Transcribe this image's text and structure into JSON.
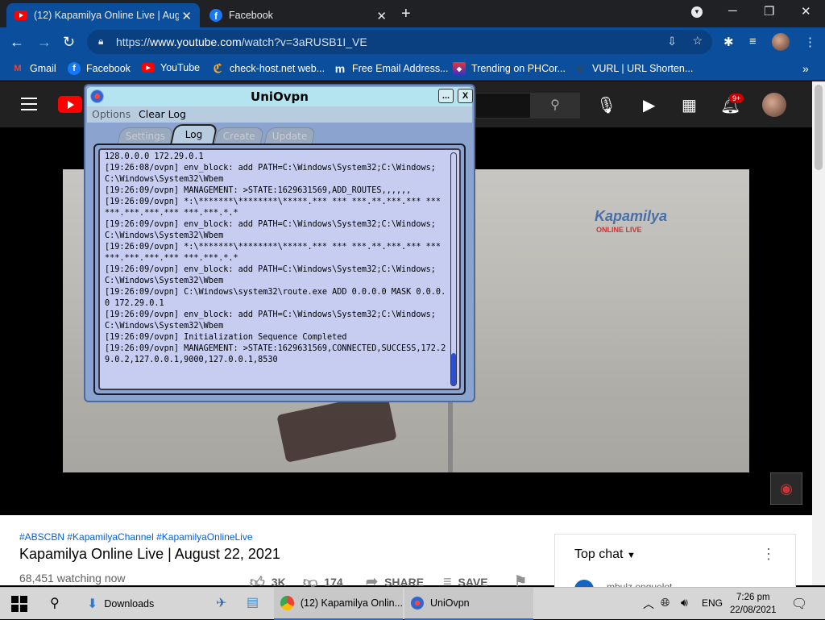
{
  "browser": {
    "tabs": [
      {
        "title": "(12) Kapamilya Online Live | Augu",
        "favicon": "youtube-icon",
        "active": true
      },
      {
        "title": "Facebook",
        "favicon": "facebook-icon",
        "active": false
      }
    ],
    "url_scheme": "https://",
    "url_host": "www.youtube.com",
    "url_path": "/watch?v=3aRUSB1I_VE",
    "bookmarks": [
      {
        "label": "Gmail",
        "icon": "gmail-icon"
      },
      {
        "label": "Facebook",
        "icon": "facebook-icon"
      },
      {
        "label": "YouTube",
        "icon": "youtube-icon"
      },
      {
        "label": "check-host.net web...",
        "icon": "check-host-icon"
      },
      {
        "label": "Free Email Address...",
        "icon": "mail-icon"
      },
      {
        "label": "Trending on PHCor...",
        "icon": "phcorner-icon"
      },
      {
        "label": "VURL | URL Shorten...",
        "icon": "vurl-icon"
      }
    ],
    "bookmarks_more": "»"
  },
  "youtube": {
    "notification_count": "9+",
    "hashtags": "#ABSCBN #KapamilyaChannel #KapamilyaOnlineLive",
    "title": "Kapamilya Online Live | August 22, 2021",
    "watching": "68,451 watching now",
    "likes": "3K",
    "dislikes": "174",
    "share_label": "SHARE",
    "save_label": "SAVE",
    "chat": {
      "label": "Top chat",
      "first_user": "mbulz enquelot"
    },
    "video_watermark": "Kapamilya",
    "video_watermark_sub": "ONLINE LIVE"
  },
  "ovpn": {
    "title": "UniOvpn",
    "minimize": "...",
    "close": "X",
    "menu": [
      "Options",
      "Clear Log"
    ],
    "tabs": [
      {
        "label": "Settings",
        "active": false
      },
      {
        "label": "Log",
        "active": true
      },
      {
        "label": "Create",
        "active": false
      },
      {
        "label": "Update",
        "active": false
      }
    ],
    "log": "128.0.0.0 172.29.0.1\n[19:26:08/ovpn] env_block: add PATH=C:\\Windows\\System32;C:\\Windows;C:\\Windows\\System32\\Wbem\n[19:26:09/ovpn] MANAGEMENT: >STATE:1629631569,ADD_ROUTES,,,,,,\n[19:26:09/ovpn] *:\\*******\\********\\*****.*** *** ***.**.***.*** *** ***.***.***.*** ***.***.*.*\n[19:26:09/ovpn] env_block: add PATH=C:\\Windows\\System32;C:\\Windows;C:\\Windows\\System32\\Wbem\n[19:26:09/ovpn] *:\\*******\\********\\*****.*** *** ***.**.***.*** *** ***.***.***.*** ***.***.*.*\n[19:26:09/ovpn] env_block: add PATH=C:\\Windows\\System32;C:\\Windows;C:\\Windows\\System32\\Wbem\n[19:26:09/ovpn] C:\\Windows\\system32\\route.exe ADD 0.0.0.0 MASK 0.0.0.0 172.29.0.1\n[19:26:09/ovpn] env_block: add PATH=C:\\Windows\\System32;C:\\Windows;C:\\Windows\\System32\\Wbem\n[19:26:09/ovpn] Initialization Sequence Completed\n[19:26:09/ovpn] MANAGEMENT: >STATE:1629631569,CONNECTED,SUCCESS,172.29.0.2,127.0.0.1,9000,127.0.0.1,8530"
  },
  "taskbar": {
    "apps": [
      {
        "label": "Downloads",
        "icon": "folder-download-icon"
      },
      {
        "label": "(12) Kapamilya Onlin...",
        "icon": "chrome-icon"
      },
      {
        "label": "UniOvpn",
        "icon": "uniovpn-icon"
      }
    ],
    "language": "ENG",
    "time": "7:26 pm",
    "date": "22/08/2021"
  },
  "colors": {
    "chrome_accent": "#0b4f9c",
    "youtube_red": "#ff0000",
    "ovpn_title_bar": "#b4e4f0",
    "ovpn_log_bg": "#c6cdf0"
  }
}
